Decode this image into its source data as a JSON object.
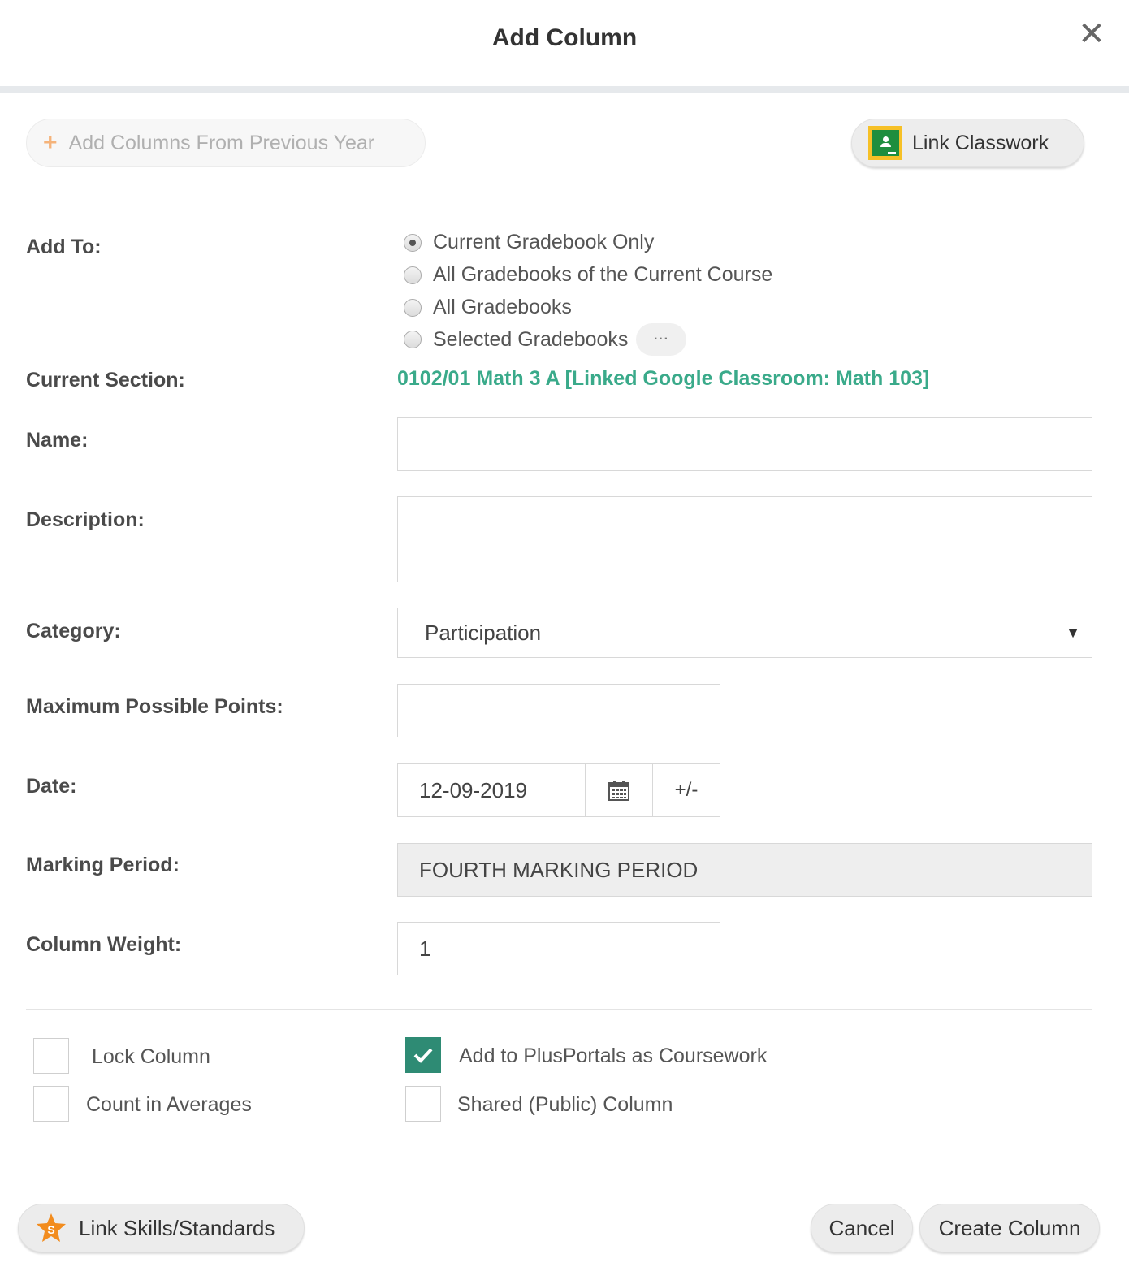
{
  "dialog": {
    "title": "Add Column",
    "close_glyph": "✕"
  },
  "toolbar": {
    "prev_year_label": "Add Columns From Previous Year",
    "link_classwork_label": "Link Classwork"
  },
  "form": {
    "add_to": {
      "label": "Add To:",
      "options": [
        {
          "label": "Current Gradebook Only",
          "checked": true
        },
        {
          "label": "All Gradebooks of the Current Course",
          "checked": false
        },
        {
          "label": "All Gradebooks",
          "checked": false
        },
        {
          "label": "Selected Gradebooks",
          "checked": false
        }
      ],
      "more_label": "···"
    },
    "current_section": {
      "label": "Current Section:",
      "value": "0102/01 Math 3 A [Linked Google Classroom: Math 103]"
    },
    "name": {
      "label": "Name:",
      "value": ""
    },
    "description": {
      "label": "Description:",
      "value": ""
    },
    "category": {
      "label": "Category:",
      "value": "Participation"
    },
    "max_points": {
      "label": "Maximum Possible Points:",
      "value": ""
    },
    "date": {
      "label": "Date:",
      "value": "12-09-2019",
      "adjust_label": "+/-"
    },
    "marking_period": {
      "label": "Marking Period:",
      "value": "FOURTH MARKING PERIOD"
    },
    "column_weight": {
      "label": "Column Weight:",
      "value": "1"
    }
  },
  "options": {
    "lock_column": {
      "label": "Lock Column",
      "checked": false
    },
    "count_in_averages": {
      "label": "Count in Averages",
      "checked": false
    },
    "add_to_plusportals": {
      "label": "Add to PlusPortals as Coursework",
      "checked": true
    },
    "shared_column": {
      "label": "Shared (Public) Column",
      "checked": false
    }
  },
  "footer": {
    "link_skills_label": "Link Skills/Standards",
    "cancel_label": "Cancel",
    "create_label": "Create Column"
  },
  "colors": {
    "accent": "#3aaa8a",
    "checkbox_checked": "#2e8b74",
    "star": "#f28c1e"
  }
}
